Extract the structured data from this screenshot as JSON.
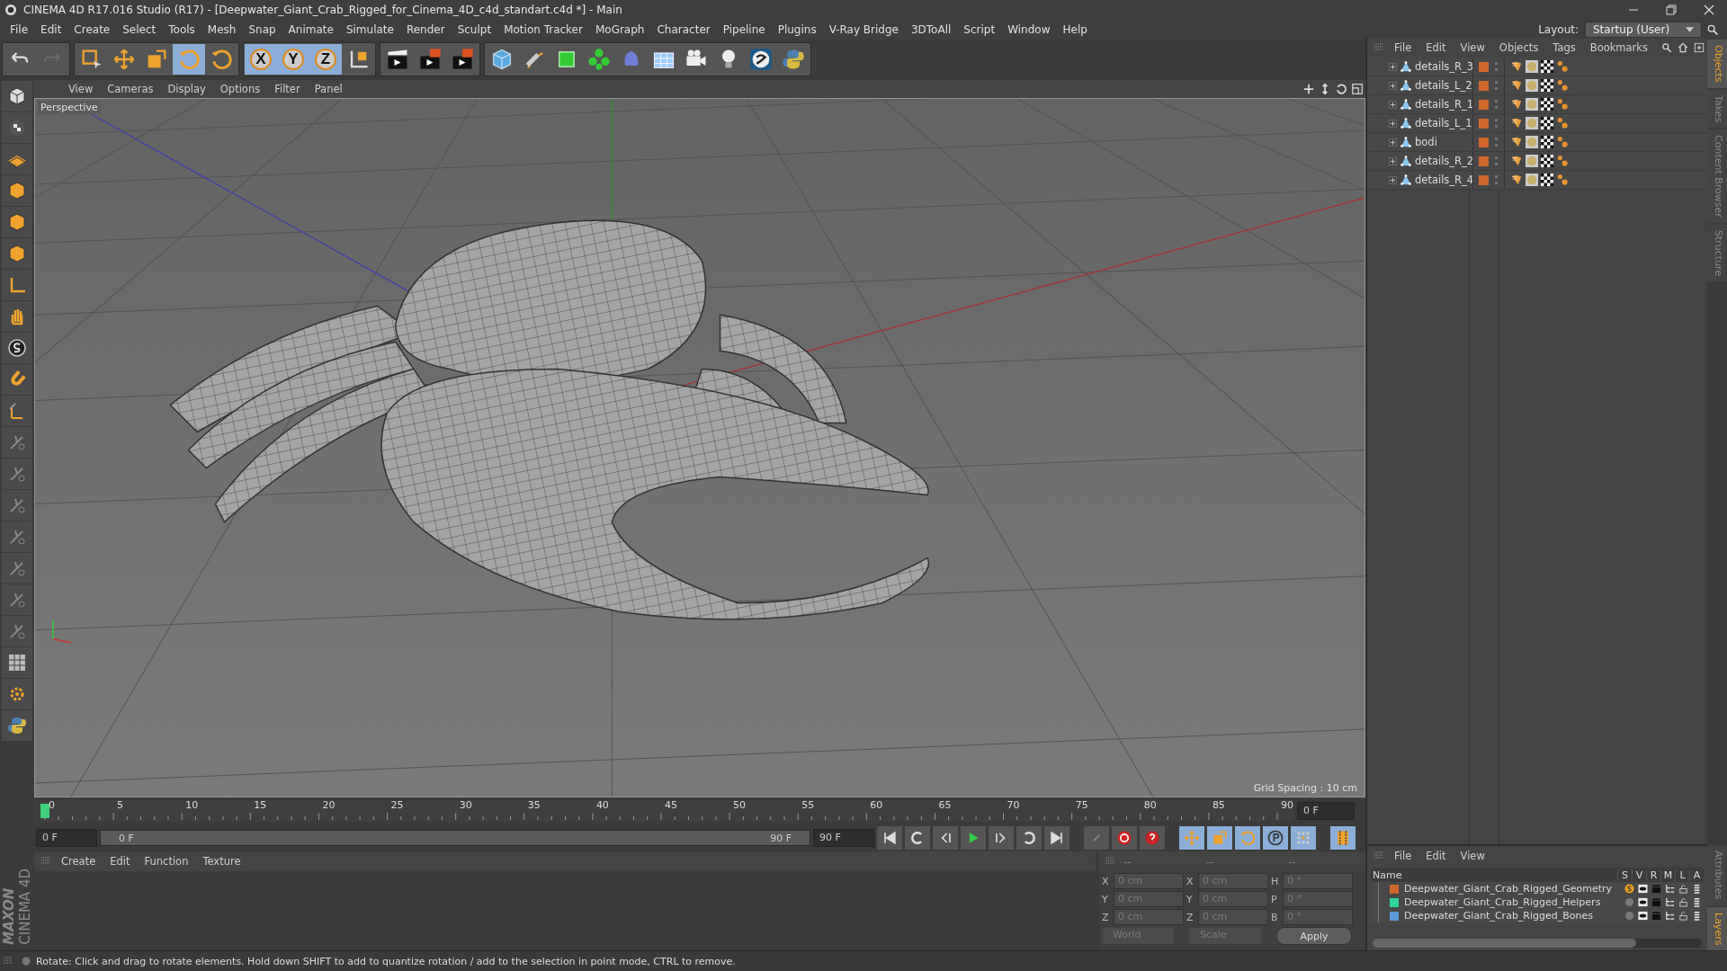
{
  "window": {
    "title": "CINEMA 4D R17.016 Studio (R17) - [Deepwater_Giant_Crab_Rigged_for_Cinema_4D_c4d_standart.c4d *] - Main",
    "layout_label": "Layout:",
    "layout_value": "Startup (User)"
  },
  "menu_bar": [
    "File",
    "Edit",
    "Create",
    "Select",
    "Tools",
    "Mesh",
    "Snap",
    "Animate",
    "Simulate",
    "Render",
    "Sculpt",
    "Motion Tracker",
    "MoGraph",
    "Character",
    "Pipeline",
    "Plugins",
    "V-Ray Bridge",
    "3DToAll",
    "Script",
    "Window",
    "Help"
  ],
  "axis_buttons": [
    {
      "label": "X",
      "selected": true
    },
    {
      "label": "Y",
      "selected": true
    },
    {
      "label": "Z",
      "selected": true
    }
  ],
  "viewport": {
    "menu": [
      "View",
      "Cameras",
      "Display",
      "Options",
      "Filter",
      "Panel"
    ],
    "label": "Perspective",
    "grid_spacing": "Grid Spacing : 10 cm"
  },
  "object_manager": {
    "menu": [
      "File",
      "Edit",
      "View",
      "Objects",
      "Tags",
      "Bookmarks"
    ],
    "objects": [
      {
        "name": "details_R_3"
      },
      {
        "name": "details_L_2"
      },
      {
        "name": "details_R_1"
      },
      {
        "name": "details_L_1"
      },
      {
        "name": "bodi"
      },
      {
        "name": "details_R_2"
      },
      {
        "name": "details_R_4"
      }
    ]
  },
  "side_tabs": [
    {
      "label": "Objects",
      "selected": true
    },
    {
      "label": "Takes",
      "selected": false
    },
    {
      "label": "Content Browser",
      "selected": false
    },
    {
      "label": "Structure",
      "selected": false
    }
  ],
  "timeline": {
    "ticks": [
      "0",
      "5",
      "10",
      "15",
      "20",
      "25",
      "30",
      "35",
      "40",
      "45",
      "50",
      "55",
      "60",
      "65",
      "70",
      "75",
      "80",
      "85",
      "90"
    ],
    "current_frame": "0 F",
    "start_field": "0 F",
    "range_start": "0 F",
    "range_end": "90 F",
    "range": {
      "level": 1
    },
    "end_field": "90 F"
  },
  "material_manager": {
    "menu": [
      "Create",
      "Edit",
      "Function",
      "Texture"
    ]
  },
  "coordinates": {
    "headers": [
      "--",
      "--",
      "--"
    ],
    "rows": [
      [
        {
          "axis": "X",
          "value": "0 cm"
        },
        {
          "axis": "X",
          "value": "0 cm"
        },
        {
          "axis": "H",
          "value": "0 °"
        }
      ],
      [
        {
          "axis": "Y",
          "value": "0 cm"
        },
        {
          "axis": "Y",
          "value": "0 cm"
        },
        {
          "axis": "P",
          "value": "0 °"
        }
      ],
      [
        {
          "axis": "Z",
          "value": "0 cm"
        },
        {
          "axis": "Z",
          "value": "0 cm"
        },
        {
          "axis": "B",
          "value": "0 °"
        }
      ]
    ],
    "mode": "World",
    "type": "Scale",
    "apply": "Apply"
  },
  "layers": {
    "menu": [
      "File",
      "Edit",
      "View"
    ],
    "columns": [
      "Name",
      "S",
      "V",
      "R",
      "M",
      "L",
      "A"
    ],
    "rows": [
      {
        "name": "Deepwater_Giant_Crab_Rigged_Geometry",
        "color": "#d0682c",
        "solo": true
      },
      {
        "name": "Deepwater_Giant_Crab_Rigged_Helpers",
        "color": "#2ed39a",
        "solo": false
      },
      {
        "name": "Deepwater_Giant_Crab_Rigged_Bones",
        "color": "#5b9ad8",
        "solo": false
      }
    ]
  },
  "bottom_tabs": [
    {
      "label": "Attributes",
      "selected": false
    },
    {
      "label": "Layers",
      "selected": true
    }
  ],
  "logo": {
    "brand": "MAXON",
    "product": "CINEMA 4D"
  },
  "status_bar": "Rotate: Click and drag to rotate elements. Hold down SHIFT to add to quantize rotation / add to the selection in point mode, CTRL to remove."
}
